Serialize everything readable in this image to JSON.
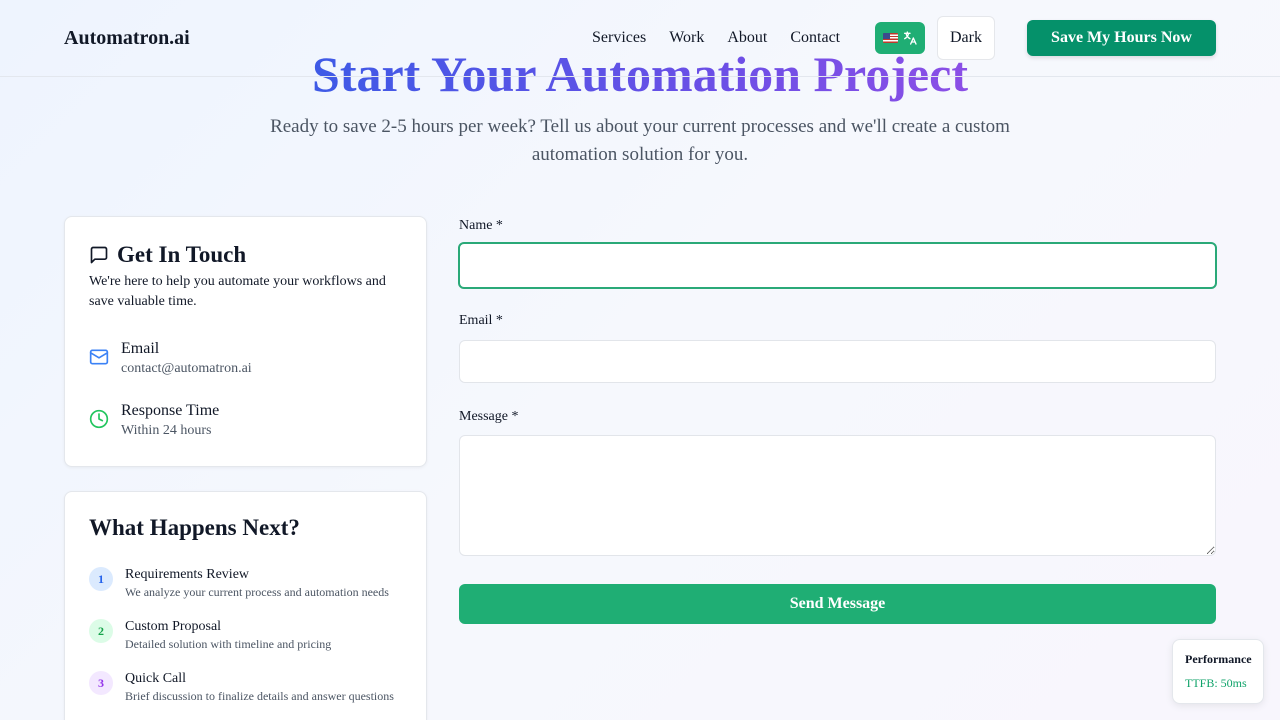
{
  "header": {
    "logo": "Automatron.ai",
    "nav": [
      "Services",
      "Work",
      "About",
      "Contact"
    ],
    "language_flag": "us-flag",
    "theme_label": "Dark",
    "cta_label": "Save My Hours Now"
  },
  "hero": {
    "title": "Start Your Automation Project",
    "subtitle": "Ready to save 2-5 hours per week? Tell us about your current processes and we'll create a custom automation solution for you."
  },
  "contact_card": {
    "title": "Get In Touch",
    "description": "We're here to help you automate your workflows and save valuable time.",
    "items": [
      {
        "label": "Email",
        "value": "contact@automatron.ai",
        "icon": "mail-icon"
      },
      {
        "label": "Response Time",
        "value": "Within 24 hours",
        "icon": "clock-icon"
      }
    ]
  },
  "next_card": {
    "title": "What Happens Next?",
    "steps": [
      {
        "num": "1",
        "title": "Requirements Review",
        "desc": "We analyze your current process and automation needs"
      },
      {
        "num": "2",
        "title": "Custom Proposal",
        "desc": "Detailed solution with timeline and pricing"
      },
      {
        "num": "3",
        "title": "Quick Call",
        "desc": "Brief discussion to finalize details and answer questions"
      }
    ]
  },
  "form": {
    "name_label": "Name *",
    "name_value": "",
    "email_label": "Email *",
    "email_value": "",
    "message_label": "Message *",
    "message_value": "",
    "submit_label": "Send Message"
  },
  "performance": {
    "title": "Performance",
    "value": "TTFB: 50ms"
  },
  "colors": {
    "accent": "#1fae74",
    "cta": "#05916a",
    "gradient_start": "#3e5ae6",
    "gradient_end": "#8b4fe6"
  }
}
